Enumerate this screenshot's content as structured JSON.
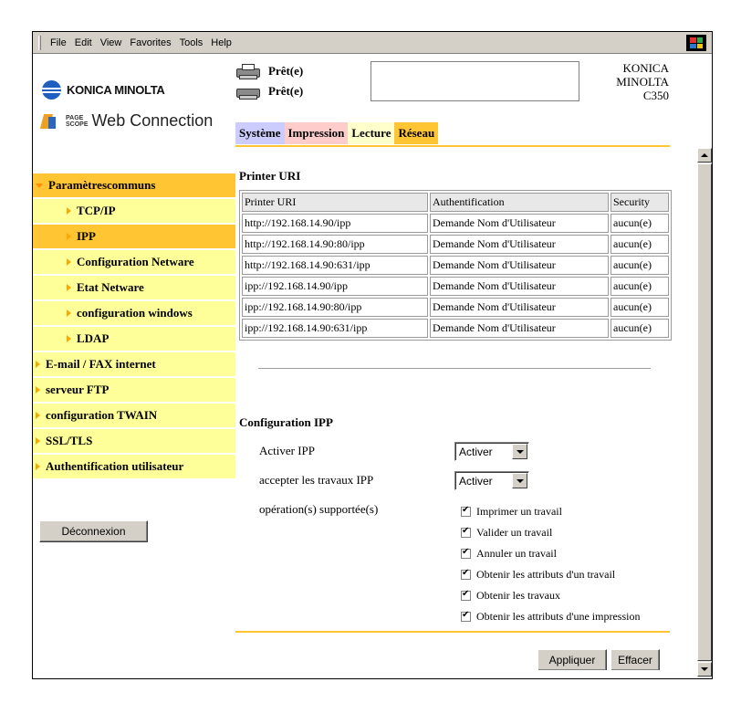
{
  "menubar": [
    "File",
    "Edit",
    "View",
    "Favorites",
    "Tools",
    "Help"
  ],
  "brand": {
    "name": "KONICA MINOLTA",
    "pagescope_top": "PAGE",
    "pagescope_bottom": "SCOPE",
    "product": "Web Connection"
  },
  "status": [
    {
      "text": "Prêt(e)"
    },
    {
      "text": "Prêt(e)"
    }
  ],
  "model": {
    "line1": "KONICA",
    "line2": "MINOLTA",
    "line3": "C350"
  },
  "tabs": {
    "systeme": "Système",
    "impression": "Impression",
    "lecture": "Lecture",
    "reseau": "Réseau"
  },
  "sidebar": {
    "items": [
      {
        "label": "Paramètrescommuns"
      },
      {
        "label": "TCP/IP"
      },
      {
        "label": "IPP"
      },
      {
        "label": "Configuration Netware"
      },
      {
        "label": "Etat Netware"
      },
      {
        "label": "configuration windows"
      },
      {
        "label": "LDAP"
      },
      {
        "label": "E-mail / FAX internet"
      },
      {
        "label": "serveur FTP"
      },
      {
        "label": "configuration TWAIN"
      },
      {
        "label": "SSL/TLS"
      },
      {
        "label": "Authentification utilisateur"
      }
    ],
    "logout": "Déconnexion"
  },
  "printer_uri": {
    "title": "Printer URI",
    "headers": [
      "Printer URI",
      "Authentification",
      "Security"
    ],
    "rows": [
      [
        "http://192.168.14.90/ipp",
        "Demande Nom d'Utilisateur",
        "aucun(e)"
      ],
      [
        "http://192.168.14.90:80/ipp",
        "Demande Nom d'Utilisateur",
        "aucun(e)"
      ],
      [
        "http://192.168.14.90:631/ipp",
        "Demande Nom d'Utilisateur",
        "aucun(e)"
      ],
      [
        "ipp://192.168.14.90/ipp",
        "Demande Nom d'Utilisateur",
        "aucun(e)"
      ],
      [
        "ipp://192.168.14.90:80/ipp",
        "Demande Nom d'Utilisateur",
        "aucun(e)"
      ],
      [
        "ipp://192.168.14.90:631/ipp",
        "Demande Nom d'Utilisateur",
        "aucun(e)"
      ]
    ]
  },
  "config": {
    "title": "Configuration IPP",
    "activer_label": "Activer IPP",
    "activer_value": "Activer",
    "accepter_label": "accepter les travaux IPP",
    "accepter_value": "Activer",
    "ops_label": "opération(s) supportée(s)",
    "ops": [
      {
        "label": "Imprimer un travail",
        "checked": true
      },
      {
        "label": "Valider un travail",
        "checked": true
      },
      {
        "label": "Annuler un travail",
        "checked": true
      },
      {
        "label": "Obtenir les attributs d'un travail",
        "checked": true
      },
      {
        "label": "Obtenir les travaux",
        "checked": true
      },
      {
        "label": "Obtenir les attributs d'une impression",
        "checked": true
      }
    ]
  },
  "buttons": {
    "apply": "Appliquer",
    "clear": "Effacer"
  }
}
